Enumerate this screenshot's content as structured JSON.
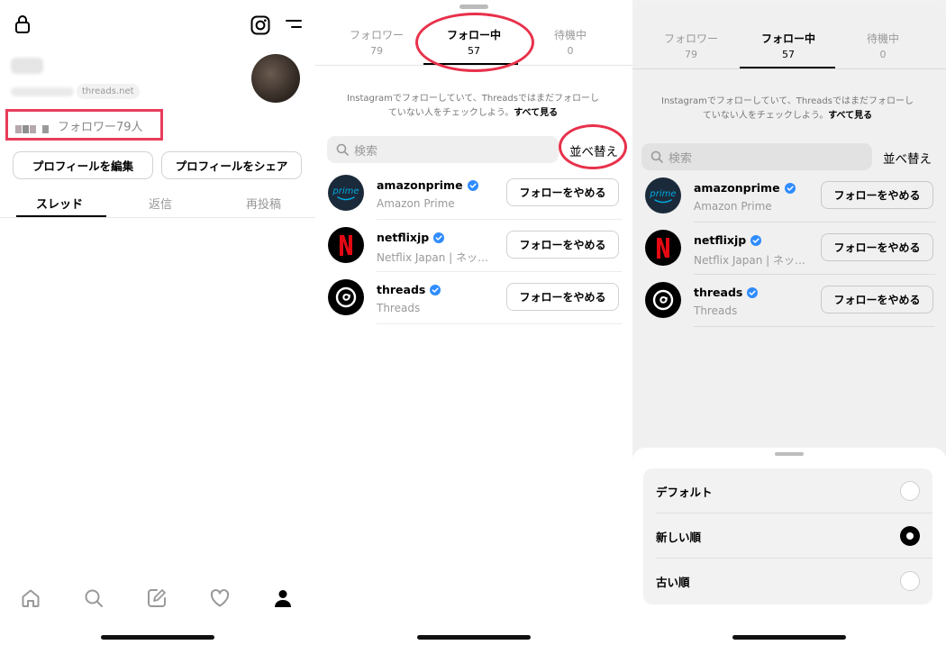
{
  "profile": {
    "domain_pill": "threads.net",
    "followers_text": "フォロワー79人",
    "edit_button": "プロフィールを編集",
    "share_button": "プロフィールをシェア",
    "tabs": [
      "スレッド",
      "返信",
      "再投稿"
    ],
    "icons": [
      "lock-icon",
      "instagram-icon",
      "menu-icon",
      "home-icon",
      "search-icon",
      "compose-icon",
      "heart-icon",
      "profile-icon"
    ]
  },
  "follow_sheet": {
    "tabs": [
      {
        "label": "フォロワー",
        "count": "79"
      },
      {
        "label": "フォロー中",
        "count": "57"
      },
      {
        "label": "待機中",
        "count": "0"
      }
    ],
    "active_tab": "フォロー中",
    "note_line1": "Instagramでフォローしていて、Threadsではまだフォローし",
    "note_line2": "ていない人をチェックしよう。",
    "note_link": "すべて見る",
    "search_placeholder": "検索",
    "sort_label": "並べ替え",
    "unfollow_label": "フォローをやめる",
    "accounts": [
      {
        "username": "amazonprime",
        "subtitle": "Amazon Prime",
        "verified": true
      },
      {
        "username": "netflixjp",
        "subtitle": "Netflix Japan | ネッ…",
        "verified": true
      },
      {
        "username": "threads",
        "subtitle": "Threads",
        "verified": true
      }
    ]
  },
  "sort_sheet": {
    "options": [
      {
        "label": "デフォルト",
        "selected": false
      },
      {
        "label": "新しい順",
        "selected": true
      },
      {
        "label": "古い順",
        "selected": false
      }
    ]
  },
  "colors": {
    "highlight_red": "#e83d5a",
    "verified_blue": "#2f8cff",
    "netflix_red": "#e50914",
    "prime_blue": "#00a8e1"
  }
}
